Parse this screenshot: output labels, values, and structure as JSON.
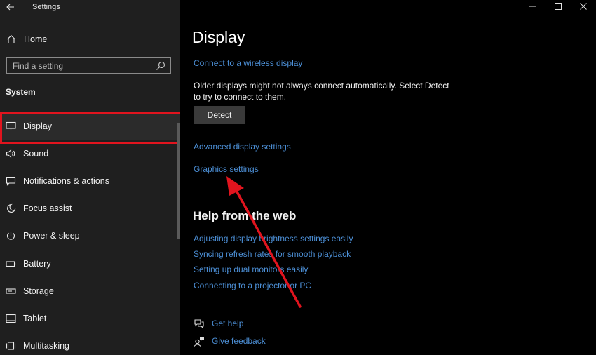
{
  "window": {
    "title": "Settings",
    "back_icon": "back-arrow-icon",
    "controls": [
      "minimize-icon",
      "maximize-icon",
      "close-icon"
    ]
  },
  "sidebar": {
    "home_label": "Home",
    "search_placeholder": "Find a setting",
    "section_label": "System",
    "items": [
      {
        "label": "Display",
        "icon": "monitor-icon",
        "selected": true
      },
      {
        "label": "Sound",
        "icon": "speaker-icon"
      },
      {
        "label": "Notifications & actions",
        "icon": "notification-icon"
      },
      {
        "label": "Focus assist",
        "icon": "moon-icon"
      },
      {
        "label": "Power & sleep",
        "icon": "power-icon"
      },
      {
        "label": "Battery",
        "icon": "battery-icon"
      },
      {
        "label": "Storage",
        "icon": "storage-icon"
      },
      {
        "label": "Tablet",
        "icon": "tablet-icon"
      },
      {
        "label": "Multitasking",
        "icon": "multitasking-icon"
      }
    ]
  },
  "main": {
    "title": "Display",
    "wireless_link": "Connect to a wireless display",
    "description": "Older displays might not always connect automatically. Select Detect to try to connect to them.",
    "detect_label": "Detect",
    "advanced_link": "Advanced display settings",
    "graphics_link": "Graphics settings",
    "help_title": "Help from the web",
    "help_links": [
      "Adjusting display brightness settings easily",
      "Syncing refresh rates for smooth playback",
      "Setting up dual monitors easily",
      "Connecting to a projector or PC"
    ],
    "get_help": "Get help",
    "give_feedback": "Give feedback"
  },
  "colors": {
    "sidebar_bg": "#1f1f1f",
    "main_bg": "#000000",
    "link": "#4c8fd6",
    "highlight_border": "#e1141e",
    "annotation_arrow": "#e1141e"
  }
}
